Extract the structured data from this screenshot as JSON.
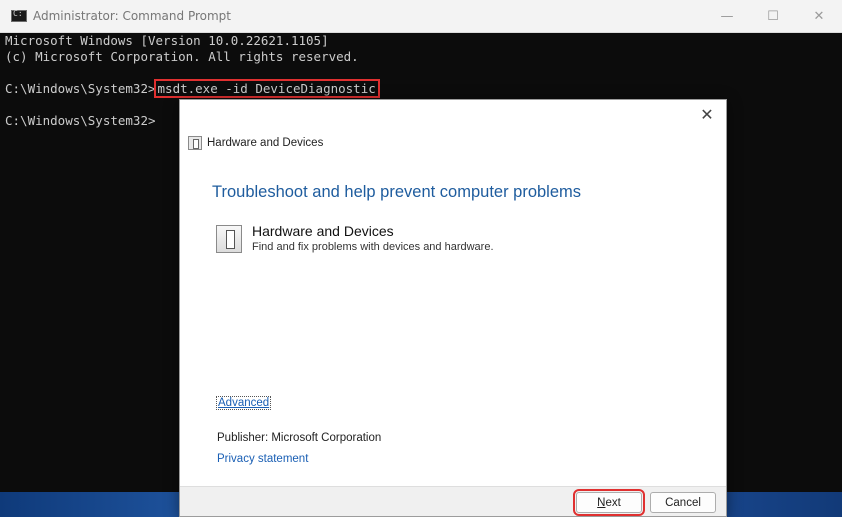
{
  "window": {
    "title": "Administrator: Command Prompt",
    "controls": {
      "minimize": "—",
      "maximize": "☐",
      "close": "✕"
    }
  },
  "console": {
    "lines": [
      "Microsoft Windows [Version 10.0.22621.1105]",
      "(c) Microsoft Corporation. All rights reserved."
    ],
    "prompt1": "C:\\Windows\\System32>",
    "command": "msdt.exe -id DeviceDiagnostic",
    "prompt2": "C:\\Windows\\System32>"
  },
  "dialog": {
    "close_glyph": "✕",
    "header": "Hardware and Devices",
    "heading": "Troubleshoot and help prevent computer problems",
    "task": {
      "title": "Hardware and Devices",
      "description": "Find and fix problems with devices and hardware."
    },
    "advanced_link": "Advanced",
    "publisher": "Publisher:  Microsoft Corporation",
    "privacy_link": "Privacy statement",
    "buttons": {
      "next_mnemonic": "N",
      "next_rest": "ext",
      "cancel": "Cancel"
    }
  },
  "colors": {
    "console_bg": "#0c0c0c",
    "console_text": "#cccccc",
    "highlight": "#e03030",
    "link": "#1a5fb4",
    "heading": "#1e5c9e"
  }
}
